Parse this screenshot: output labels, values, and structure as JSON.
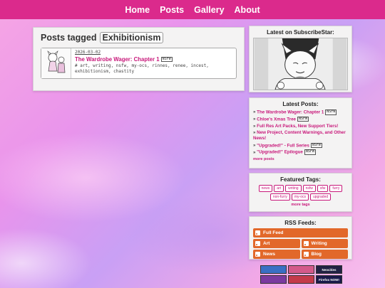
{
  "nav": {
    "items": [
      "Home",
      "Posts",
      "Gallery",
      "About"
    ]
  },
  "main": {
    "heading_prefix": "Posts tagged",
    "tag": "Exhibitionism",
    "post": {
      "date": "2026-03-02",
      "title": "The Wardrobe Wager: Chapter 1",
      "badge": "NSFW",
      "tags_line1": "# art, writing, nsfw, my-ocs, rinnes, renee, incest,",
      "tags_line2": "exhibitionism, chastity"
    }
  },
  "subscribestar": {
    "heading": "Latest on SubscribeStar:"
  },
  "latest": {
    "heading": "Latest Posts:",
    "items": [
      {
        "title": "The Wardrobe Wager: Chapter 1",
        "badge": "NSFW"
      },
      {
        "title": "Chloe's Xmas Tree",
        "badge": "NSFW"
      },
      {
        "title": "Full Res Art Packs, New Support Tiers!",
        "badge": ""
      },
      {
        "title": "New Project, Content Warnings, and Other News!",
        "badge": ""
      },
      {
        "title": "\"Upgraded!\" - Full Series",
        "badge": "NSFW"
      },
      {
        "title": "\"Upgraded!\" Epilogue",
        "badge": "NSFW"
      }
    ],
    "more": "more posts"
  },
  "featured": {
    "heading": "Featured Tags:",
    "tags": [
      "news",
      "art",
      "writing",
      "nsfw",
      "sfw",
      "furry",
      "non-furry",
      "my-ocs",
      "upgraded"
    ],
    "more": "more tags"
  },
  "rss": {
    "heading": "RSS Feeds:",
    "full": "Full Feed",
    "art": "Art",
    "writing": "Writing",
    "news": "News",
    "blog": "Blog"
  },
  "badges88": [
    {
      "label": "",
      "color": "#3a6fc4"
    },
    {
      "label": "",
      "color": "#d45a8a"
    },
    {
      "label": "Neocities",
      "color": "#222244"
    },
    {
      "label": "",
      "color": "#7a3aa0"
    },
    {
      "label": "",
      "color": "#c43a4a"
    },
    {
      "label": "Firefox NOW!",
      "color": "#1a1a4a"
    }
  ],
  "colors": {
    "accent": "#db2a8c",
    "link": "#c8187a",
    "rss": "#e2682a"
  }
}
